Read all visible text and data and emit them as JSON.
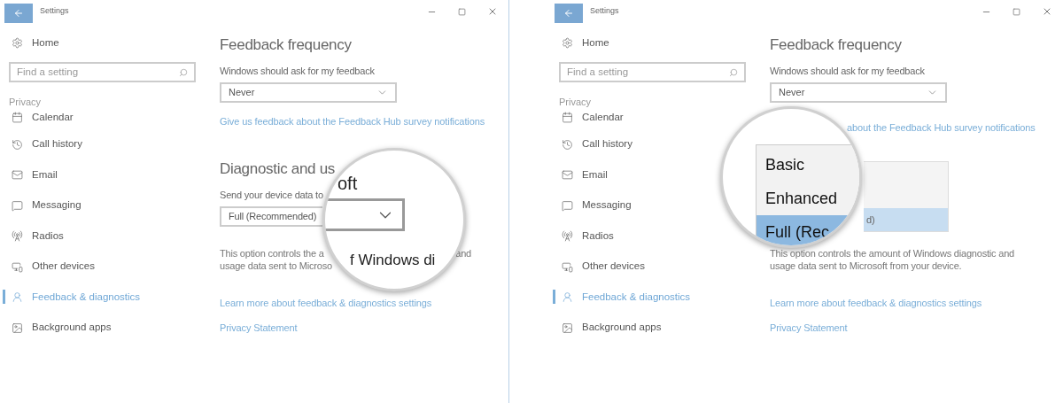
{
  "windows": [
    {
      "title": "Settings",
      "home": "Home",
      "search": {
        "placeholder": "Find a setting"
      },
      "section": "Privacy",
      "nav": [
        {
          "label": "Calendar",
          "selected": false
        },
        {
          "label": "Call history",
          "selected": false
        },
        {
          "label": "Email",
          "selected": false
        },
        {
          "label": "Messaging",
          "selected": false
        },
        {
          "label": "Radios",
          "selected": false
        },
        {
          "label": "Other devices",
          "selected": false
        },
        {
          "label": "Feedback & diagnostics",
          "selected": true
        },
        {
          "label": "Background apps",
          "selected": false
        }
      ],
      "content": [
        {
          "kind": "heading",
          "text": "Feedback frequency"
        },
        {
          "kind": "label",
          "text": "Windows should ask for my feedback"
        },
        {
          "kind": "select",
          "value": "Never"
        },
        {
          "kind": "link",
          "text": "Give us feedback about the Feedback Hub survey notifications"
        },
        {
          "kind": "heading",
          "text": "Diagnostic and us"
        },
        {
          "kind": "label",
          "text": "Send your device data to"
        },
        {
          "kind": "select-partial",
          "value": "Full (Recommended)"
        },
        {
          "kind": "paragraph-broken",
          "lines": [
            [
              "This option controls the a",
              "and"
            ],
            [
              "usage data sent to Microso"
            ]
          ]
        },
        {
          "kind": "link",
          "text": "Learn more about feedback & diagnostics settings"
        },
        {
          "kind": "link",
          "text": "Privacy Statement"
        }
      ],
      "magnifier": {
        "kind": "dropdown",
        "top_text": "oft",
        "bottom_text": "f Windows di"
      }
    },
    {
      "title": "Settings",
      "home": "Home",
      "search": {
        "placeholder": "Find a setting"
      },
      "section": "Privacy",
      "nav": [
        {
          "label": "Calendar",
          "selected": false
        },
        {
          "label": "Call history",
          "selected": false
        },
        {
          "label": "Email",
          "selected": false
        },
        {
          "label": "Messaging",
          "selected": false
        },
        {
          "label": "Radios",
          "selected": false
        },
        {
          "label": "Other devices",
          "selected": false
        },
        {
          "label": "Feedback & diagnostics",
          "selected": true
        },
        {
          "label": "Background apps",
          "selected": false
        }
      ],
      "content": [
        {
          "kind": "heading",
          "text": "Feedback frequency"
        },
        {
          "kind": "label",
          "text": "Windows should ask for my feedback"
        },
        {
          "kind": "select",
          "value": "Never"
        },
        {
          "kind": "link-partial",
          "text": "about the Feedback Hub survey notifications"
        },
        {
          "kind": "dropdown-list",
          "selected_option": "d)"
        },
        {
          "kind": "paragraph",
          "lines": [
            "This option controls the amount of Windows diagnostic and",
            "usage data sent to Microsoft from your device."
          ]
        },
        {
          "kind": "link",
          "text": "Learn more about feedback & diagnostics settings"
        },
        {
          "kind": "link",
          "text": "Privacy Statement"
        }
      ],
      "magnifier": {
        "kind": "list",
        "options": [
          {
            "label": "Basic",
            "selected": false
          },
          {
            "label": "Enhanced",
            "selected": false
          },
          {
            "label": "Full (Rec",
            "selected": true
          }
        ]
      }
    }
  ]
}
